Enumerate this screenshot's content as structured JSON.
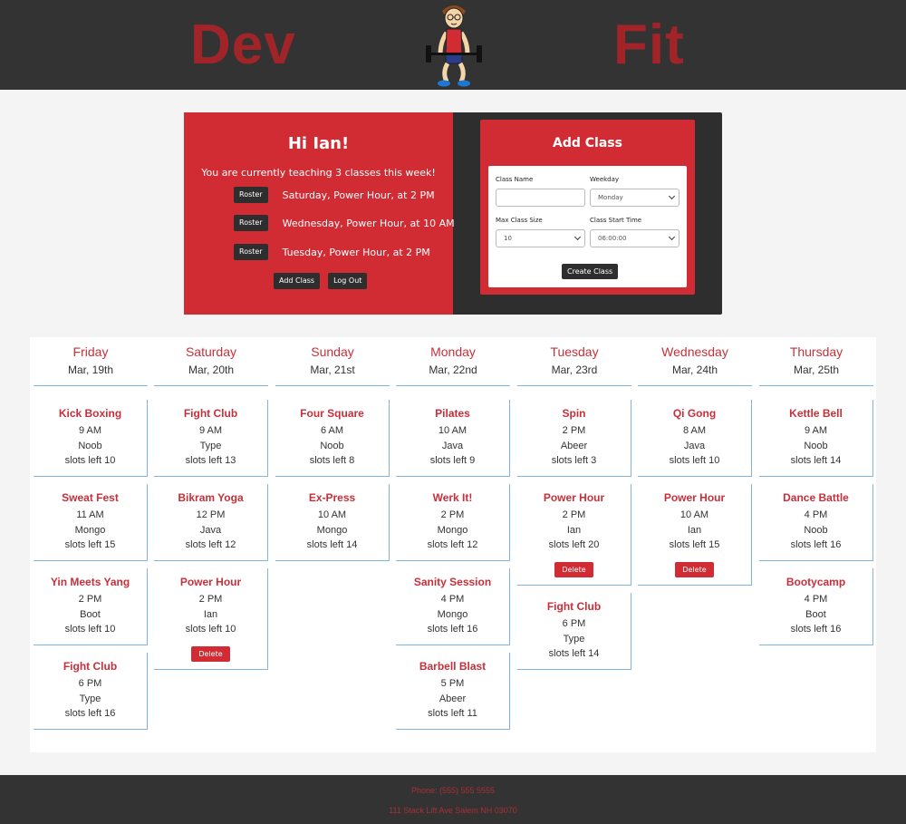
{
  "header": {
    "brand_left": "Dev",
    "brand_right": "Fit",
    "logo_icon": "weightlifter-mascot-icon"
  },
  "colors": {
    "header_bg": "#333333",
    "brand_red": "#d12c34",
    "accent_blue": "#7fb5e0"
  },
  "welcome": {
    "greeting": "Hi Ian!",
    "summary": "You are currently teaching 3 classes this week!",
    "classes": [
      {
        "button": "Roster",
        "label": "Saturday, Power Hour, at 2 PM"
      },
      {
        "button": "Roster",
        "label": "Wednesday, Power Hour, at 10 AM"
      },
      {
        "button": "Roster",
        "label": "Tuesday, Power Hour, at 2 PM"
      }
    ],
    "add_class_button": "Add Class",
    "logout_button": "Log Out"
  },
  "add_class": {
    "title": "Add Class",
    "class_name_label": "Class Name",
    "class_name_value": "",
    "weekday_label": "Weekday",
    "weekday_value": "Monday",
    "max_size_label": "Max Class Size",
    "max_size_value": "10",
    "start_time_label": "Class Start Time",
    "start_time_value": "06:00:00",
    "submit": "Create Class"
  },
  "schedule": [
    {
      "day": "Friday",
      "date": "Mar, 19th",
      "classes": [
        {
          "name": "Kick Boxing",
          "time": "9 AM",
          "instructor": "Noob",
          "slots": "slots left 10"
        },
        {
          "name": "Sweat Fest",
          "time": "11 AM",
          "instructor": "Mongo",
          "slots": "slots left 15"
        },
        {
          "name": "Yin Meets Yang",
          "time": "2 PM",
          "instructor": "Boot",
          "slots": "slots left 10"
        },
        {
          "name": "Fight Club",
          "time": "6 PM",
          "instructor": "Type",
          "slots": "slots left 16"
        }
      ]
    },
    {
      "day": "Saturday",
      "date": "Mar, 20th",
      "classes": [
        {
          "name": "Fight Club",
          "time": "9 AM",
          "instructor": "Type",
          "slots": "slots left 13"
        },
        {
          "name": "Bikram Yoga",
          "time": "12 PM",
          "instructor": "Java",
          "slots": "slots left 12"
        },
        {
          "name": "Power Hour",
          "time": "2 PM",
          "instructor": "Ian",
          "slots": "slots left 10",
          "delete": "Delete"
        }
      ]
    },
    {
      "day": "Sunday",
      "date": "Mar, 21st",
      "classes": [
        {
          "name": "Four Square",
          "time": "6 AM",
          "instructor": "Noob",
          "slots": "slots left 8"
        },
        {
          "name": "Ex-Press",
          "time": "10 AM",
          "instructor": "Mongo",
          "slots": "slots left 14"
        }
      ]
    },
    {
      "day": "Monday",
      "date": "Mar, 22nd",
      "classes": [
        {
          "name": "Pilates",
          "time": "10 AM",
          "instructor": "Java",
          "slots": "slots left 9"
        },
        {
          "name": "Werk It!",
          "time": "2 PM",
          "instructor": "Mongo",
          "slots": "slots left 12"
        },
        {
          "name": "Sanity Session",
          "time": "4 PM",
          "instructor": "Mongo",
          "slots": "slots left 16"
        },
        {
          "name": "Barbell Blast",
          "time": "5 PM",
          "instructor": "Abeer",
          "slots": "slots left 11"
        }
      ]
    },
    {
      "day": "Tuesday",
      "date": "Mar, 23rd",
      "classes": [
        {
          "name": "Spin",
          "time": "2 PM",
          "instructor": "Abeer",
          "slots": "slots left 3"
        },
        {
          "name": "Power Hour",
          "time": "2 PM",
          "instructor": "Ian",
          "slots": "slots left 20",
          "delete": "Delete"
        },
        {
          "name": "Fight Club",
          "time": "6 PM",
          "instructor": "Type",
          "slots": "slots left 14"
        }
      ]
    },
    {
      "day": "Wednesday",
      "date": "Mar, 24th",
      "classes": [
        {
          "name": "Qi Gong",
          "time": "8 AM",
          "instructor": "Java",
          "slots": "slots left 10"
        },
        {
          "name": "Power Hour",
          "time": "10 AM",
          "instructor": "Ian",
          "slots": "slots left 15",
          "delete": "Delete"
        }
      ]
    },
    {
      "day": "Thursday",
      "date": "Mar, 25th",
      "classes": [
        {
          "name": "Kettle Bell",
          "time": "9 AM",
          "instructor": "Noob",
          "slots": "slots left 14"
        },
        {
          "name": "Dance Battle",
          "time": "4 PM",
          "instructor": "Noob",
          "slots": "slots left 16"
        },
        {
          "name": "Bootycamp",
          "time": "4 PM",
          "instructor": "Boot",
          "slots": "slots left 16"
        }
      ]
    }
  ],
  "footer": {
    "phone": "Phone: (555) 555 5555",
    "address": "111 Stack Lift Ave Salem NH 03070"
  }
}
